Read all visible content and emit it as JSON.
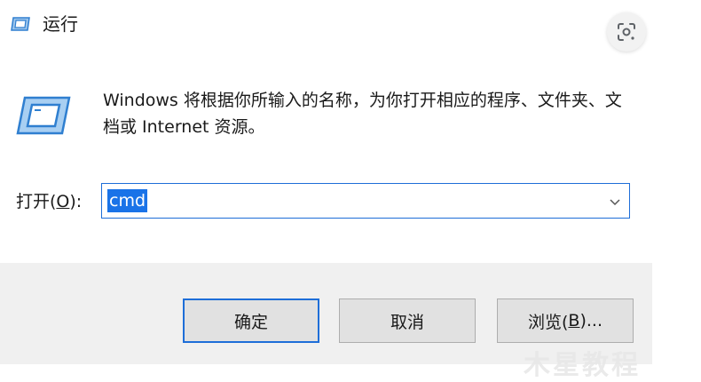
{
  "window": {
    "title": "运行",
    "colors": {
      "accent": "#1e6ed8",
      "icon": "#2f7fd0",
      "footer_bg": "#f0f0f0"
    }
  },
  "overlay": {
    "lens_icon": "google-lens-icon"
  },
  "description": "Windows 将根据你所输入的名称，为你打开相应的程序、文件夹、文档或 Internet 资源。",
  "open": {
    "label_prefix": "打开(",
    "label_accel": "O",
    "label_suffix": "):",
    "value": "cmd"
  },
  "buttons": {
    "ok": "确定",
    "cancel": "取消",
    "browse_prefix": "浏览(",
    "browse_accel": "B",
    "browse_suffix": ")..."
  },
  "watermark": "木星教程"
}
